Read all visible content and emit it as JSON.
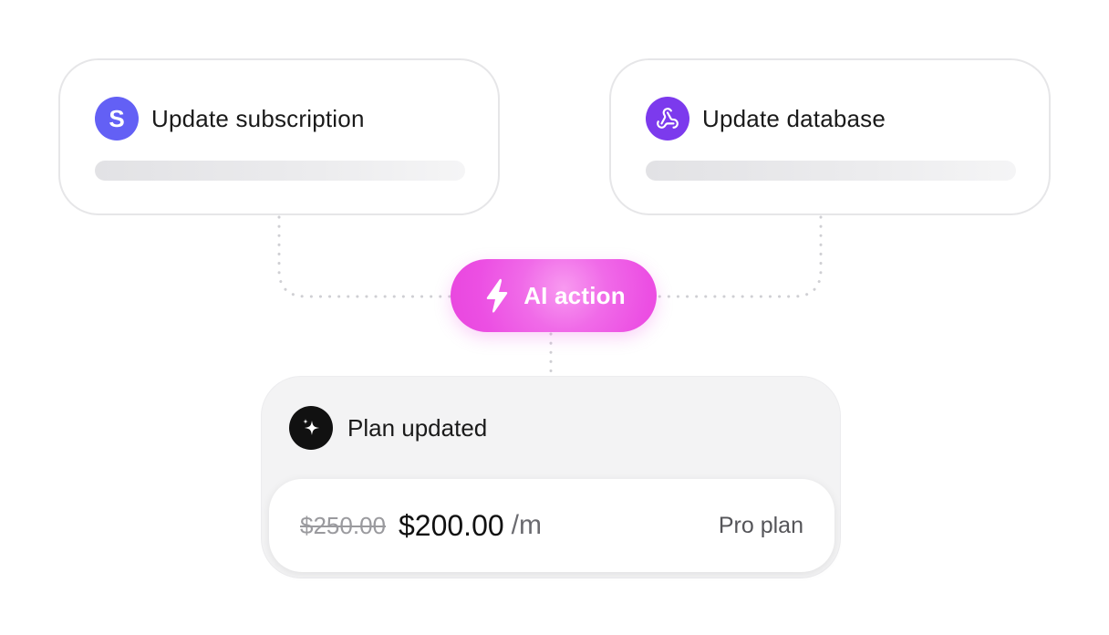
{
  "cards": {
    "subscription": {
      "title": "Update subscription",
      "badge_letter": "S",
      "icon": "stripe-logo-icon"
    },
    "database": {
      "title": "Update database",
      "icon": "webhook-icon"
    }
  },
  "ai_action": {
    "label": "AI action",
    "icon": "lightning-bolt-icon"
  },
  "result": {
    "title": "Plan updated",
    "icon": "sparkle-icon",
    "old_price": "$250.00",
    "new_price": "$200.00",
    "period": "/m",
    "plan_name": "Pro plan"
  },
  "colors": {
    "stripe_purple": "#6360f5",
    "webhook_violet": "#7c3aed",
    "ai_pink": "#ec4fe3",
    "dark": "#111111"
  }
}
